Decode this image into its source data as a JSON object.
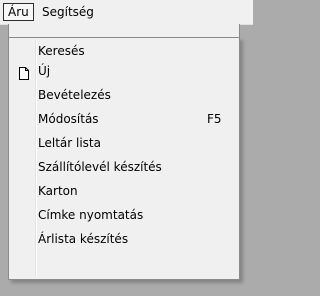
{
  "menubar": {
    "items": [
      {
        "label": "Áru",
        "active": true
      },
      {
        "label": "Segítség",
        "active": false
      }
    ]
  },
  "dropdown": {
    "items": [
      {
        "label": "Keresés"
      },
      {
        "label": "Új",
        "icon": "new-document-icon"
      },
      {
        "label": "Bevételezés"
      },
      {
        "label": "Módosítás",
        "shortcut": "F5"
      },
      {
        "label": "Leltár lista"
      },
      {
        "label": "Szállítólevél készítés"
      },
      {
        "label": "Karton"
      },
      {
        "label": "Címke nyomtatás"
      },
      {
        "label": "Árlista készítés"
      }
    ]
  }
}
